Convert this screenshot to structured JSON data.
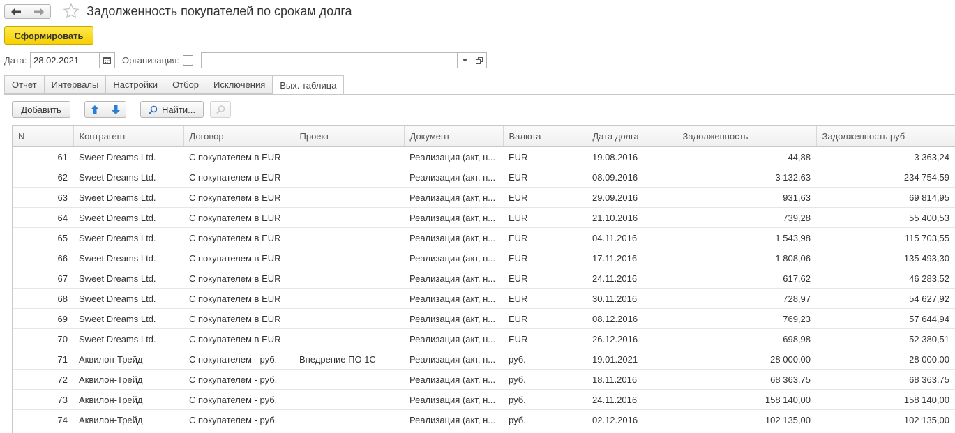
{
  "window": {
    "title": "Задолженность покупателей по срокам долга"
  },
  "toolbar": {
    "run_label": "Сформировать"
  },
  "params": {
    "date_label": "Дата:",
    "date_value": "28.02.2021",
    "org_label": "Организация:",
    "org_value": ""
  },
  "tabs": [
    {
      "label": "Отчет"
    },
    {
      "label": "Интервалы"
    },
    {
      "label": "Настройки"
    },
    {
      "label": "Отбор"
    },
    {
      "label": "Исключения"
    },
    {
      "label": "Вых. таблица",
      "active": true
    }
  ],
  "table_toolbar": {
    "add_label": "Добавить",
    "find_label": "Найти..."
  },
  "table": {
    "columns": [
      "N",
      "Контрагент",
      "Договор",
      "Проект",
      "Документ",
      "Валюта",
      "Дата долга",
      "Задолженность",
      "Задолженность руб"
    ],
    "rows": [
      [
        "61",
        "Sweet Dreams Ltd.",
        "С покупателем в EUR",
        "",
        "Реализация (акт, н...",
        "EUR",
        "19.08.2016",
        "44,88",
        "3 363,24"
      ],
      [
        "62",
        "Sweet Dreams Ltd.",
        "С покупателем в EUR",
        "",
        "Реализация (акт, н...",
        "EUR",
        "08.09.2016",
        "3 132,63",
        "234 754,59"
      ],
      [
        "63",
        "Sweet Dreams Ltd.",
        "С покупателем в EUR",
        "",
        "Реализация (акт, н...",
        "EUR",
        "29.09.2016",
        "931,63",
        "69 814,95"
      ],
      [
        "64",
        "Sweet Dreams Ltd.",
        "С покупателем в EUR",
        "",
        "Реализация (акт, н...",
        "EUR",
        "21.10.2016",
        "739,28",
        "55 400,53"
      ],
      [
        "65",
        "Sweet Dreams Ltd.",
        "С покупателем в EUR",
        "",
        "Реализация (акт, н...",
        "EUR",
        "04.11.2016",
        "1 543,98",
        "115 703,55"
      ],
      [
        "66",
        "Sweet Dreams Ltd.",
        "С покупателем в EUR",
        "",
        "Реализация (акт, н...",
        "EUR",
        "17.11.2016",
        "1 808,06",
        "135 493,30"
      ],
      [
        "67",
        "Sweet Dreams Ltd.",
        "С покупателем в EUR",
        "",
        "Реализация (акт, н...",
        "EUR",
        "24.11.2016",
        "617,62",
        "46 283,52"
      ],
      [
        "68",
        "Sweet Dreams Ltd.",
        "С покупателем в EUR",
        "",
        "Реализация (акт, н...",
        "EUR",
        "30.11.2016",
        "728,97",
        "54 627,92"
      ],
      [
        "69",
        "Sweet Dreams Ltd.",
        "С покупателем в EUR",
        "",
        "Реализация (акт, н...",
        "EUR",
        "08.12.2016",
        "769,23",
        "57 644,94"
      ],
      [
        "70",
        "Sweet Dreams Ltd.",
        "С покупателем в EUR",
        "",
        "Реализация (акт, н...",
        "EUR",
        "26.12.2016",
        "698,98",
        "52 380,51"
      ],
      [
        "71",
        "Аквилон-Трейд",
        "С покупателем - руб.",
        "Внедрение ПО 1С",
        "Реализация (акт, н...",
        "руб.",
        "19.01.2021",
        "28 000,00",
        "28 000,00"
      ],
      [
        "72",
        "Аквилон-Трейд",
        "С покупателем - руб.",
        "",
        "Реализация (акт, н...",
        "руб.",
        "18.11.2016",
        "68 363,75",
        "68 363,75"
      ],
      [
        "73",
        "Аквилон-Трейд",
        "С покупателем - руб.",
        "",
        "Реализация (акт, н...",
        "руб.",
        "24.11.2016",
        "158 140,00",
        "158 140,00"
      ],
      [
        "74",
        "Аквилон-Трейд",
        "С покупателем - руб.",
        "",
        "Реализация (акт, н...",
        "руб.",
        "02.12.2016",
        "102 135,00",
        "102 135,00"
      ]
    ]
  },
  "colors": {
    "accent_button": "#f5d000",
    "arrow_blue": "#2a7fd4"
  }
}
